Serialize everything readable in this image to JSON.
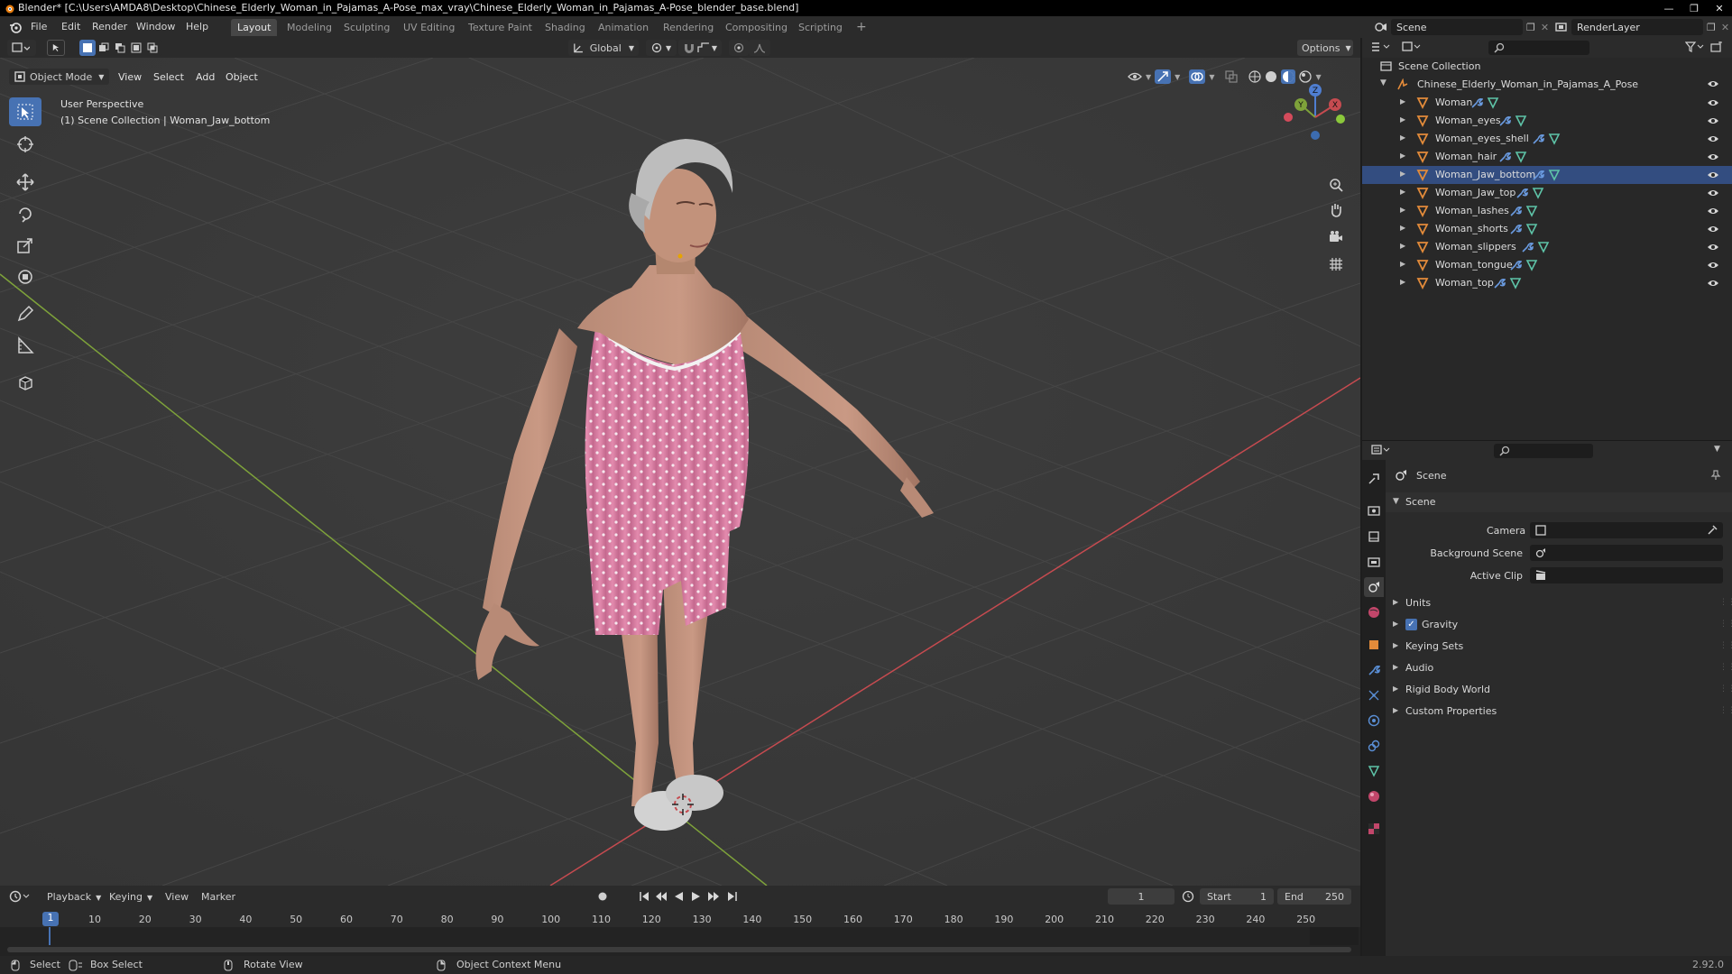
{
  "window": {
    "title": "Blender* [C:\\Users\\AMDA8\\Desktop\\Chinese_Elderly_Woman_in_Pajamas_A-Pose_max_vray\\Chinese_Elderly_Woman_in_Pajamas_A-Pose_blender_base.blend]"
  },
  "menu": [
    "File",
    "Edit",
    "Render",
    "Window",
    "Help"
  ],
  "workspaces": [
    "Layout",
    "Modeling",
    "Sculpting",
    "UV Editing",
    "Texture Paint",
    "Shading",
    "Animation",
    "Rendering",
    "Compositing",
    "Scripting"
  ],
  "active_workspace": "Layout",
  "top_right": {
    "scene": "Scene",
    "view_layer": "RenderLayer"
  },
  "viewport_header": {
    "mode": "Object Mode",
    "menus": [
      "View",
      "Select",
      "Add",
      "Object"
    ],
    "orientation": "Global",
    "options": "Options"
  },
  "viewport": {
    "perspective": "User Perspective",
    "collection": "(1) Scene Collection | Woman_Jaw_bottom",
    "gizmo": {
      "z": "Z",
      "y": "Y",
      "x": "X"
    }
  },
  "outliner": {
    "root": "Scene Collection",
    "collection": "Chinese_Elderly_Woman_in_Pajamas_A_Pose",
    "objects": [
      "Woman",
      "Woman_eyes",
      "Woman_eyes_shell",
      "Woman_hair",
      "Woman_Jaw_bottom",
      "Woman_Jaw_top",
      "Woman_lashes",
      "Woman_shorts",
      "Woman_slippers",
      "Woman_tongue",
      "Woman_top"
    ],
    "selected": "Woman_Jaw_bottom"
  },
  "properties": {
    "context": "Scene",
    "panel": "Scene",
    "fields": {
      "camera": "Camera",
      "background": "Background Scene",
      "clip": "Active Clip"
    },
    "sections": [
      "Units",
      "Gravity",
      "Keying Sets",
      "Audio",
      "Rigid Body World",
      "Custom Properties"
    ],
    "gravity_checked": true
  },
  "timeline": {
    "menus": [
      "Playback",
      "Keying",
      "View",
      "Marker"
    ],
    "current_frame": "1",
    "start_label": "Start",
    "start": "1",
    "end_label": "End",
    "end": "250",
    "ruler": [
      "1",
      "10",
      "20",
      "30",
      "40",
      "50",
      "60",
      "70",
      "80",
      "90",
      "100",
      "110",
      "120",
      "130",
      "140",
      "150",
      "160",
      "170",
      "180",
      "190",
      "200",
      "210",
      "220",
      "230",
      "240",
      "250"
    ]
  },
  "status": {
    "select": "Select",
    "box_select": "Box Select",
    "rotate": "Rotate View",
    "context_menu": "Object Context Menu",
    "version": "2.92.0"
  },
  "colors": {
    "accent": "#4772b3",
    "selection": "#334d80",
    "object_icon": "#e38b3a",
    "mesh_icon": "#5ec4a8",
    "axis_x": "#c64b50",
    "axis_y": "#7ea23a"
  }
}
